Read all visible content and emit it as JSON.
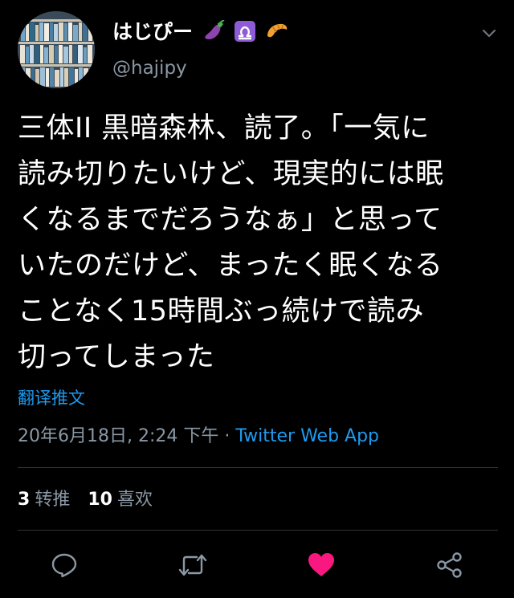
{
  "user": {
    "display_name": "はじぴー",
    "handle": "@hajipy",
    "name_emojis": [
      "eggplant-icon",
      "libra-icon",
      "croissant-icon"
    ]
  },
  "tweet": {
    "lines": [
      "三体II 黒暗森林、読了。「一気に",
      "読み切りたいけど、現実的には眠",
      "くなるまでだろうなぁ」と思って",
      "いたのだけど、まったく眠くなる",
      "ことなく15時間ぶっ続けで読み",
      "切ってしまった"
    ],
    "translate_label": "翻译推文",
    "timestamp": "20年6月18日, 2:24 下午",
    "separator": " · ",
    "source": "Twitter Web App"
  },
  "stats": {
    "retweets_count": "3",
    "retweets_label": "转推",
    "likes_count": "10",
    "likes_label": "喜欢"
  },
  "colors": {
    "background": "#000000",
    "text": "#ffffff",
    "secondary": "#8b98a5",
    "link": "#1d9bf0",
    "like": "#f91880",
    "divider": "#2f3336"
  },
  "actions": [
    "reply-icon",
    "retweet-icon",
    "like-icon",
    "share-icon"
  ]
}
